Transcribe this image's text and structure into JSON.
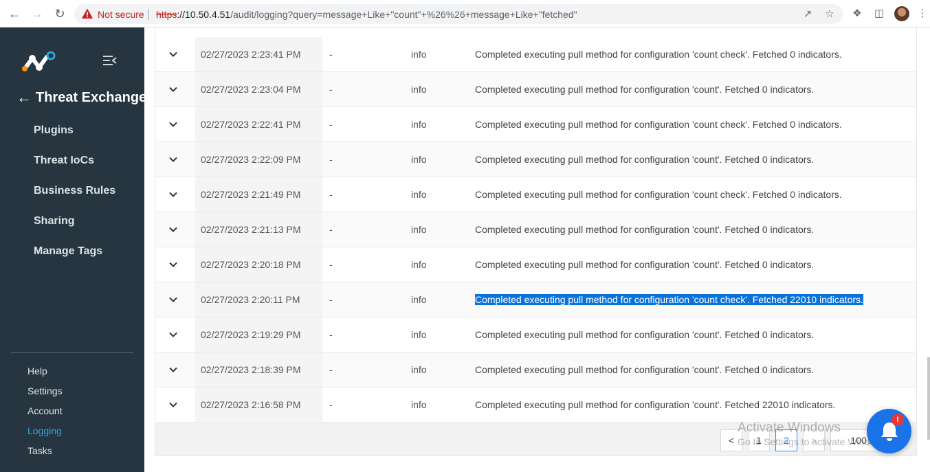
{
  "browser": {
    "security_label": "Not secure",
    "url_protocol": "https",
    "url_host": "://10.50.4.51",
    "url_path": "/audit/logging?query=message+Like+\"count\"+%26%26+message+Like+\"fetched\""
  },
  "sidebar": {
    "title": "Threat Exchange",
    "items": [
      {
        "label": "Plugins"
      },
      {
        "label": "Threat IoCs"
      },
      {
        "label": "Business Rules"
      },
      {
        "label": "Sharing"
      },
      {
        "label": "Manage Tags"
      }
    ],
    "bottom_items": [
      {
        "label": "Help"
      },
      {
        "label": "Settings"
      },
      {
        "label": "Account"
      },
      {
        "label": "Logging",
        "active": true
      },
      {
        "label": "Tasks"
      }
    ]
  },
  "logs": {
    "rows": [
      {
        "timestamp": "02/27/2023 2:23:41 PM",
        "source": "-",
        "level": "info",
        "message": "Completed executing pull method for configuration 'count check'. Fetched 0 indicators."
      },
      {
        "timestamp": "02/27/2023 2:23:04 PM",
        "source": "-",
        "level": "info",
        "message": "Completed executing pull method for configuration 'count'. Fetched 0 indicators."
      },
      {
        "timestamp": "02/27/2023 2:22:41 PM",
        "source": "-",
        "level": "info",
        "message": "Completed executing pull method for configuration 'count check'. Fetched 0 indicators."
      },
      {
        "timestamp": "02/27/2023 2:22:09 PM",
        "source": "-",
        "level": "info",
        "message": "Completed executing pull method for configuration 'count'. Fetched 0 indicators."
      },
      {
        "timestamp": "02/27/2023 2:21:49 PM",
        "source": "-",
        "level": "info",
        "message": "Completed executing pull method for configuration 'count check'. Fetched 0 indicators."
      },
      {
        "timestamp": "02/27/2023 2:21:13 PM",
        "source": "-",
        "level": "info",
        "message": "Completed executing pull method for configuration 'count'. Fetched 0 indicators."
      },
      {
        "timestamp": "02/27/2023 2:20:18 PM",
        "source": "-",
        "level": "info",
        "message": "Completed executing pull method for configuration 'count'. Fetched 0 indicators."
      },
      {
        "timestamp": "02/27/2023 2:20:11 PM",
        "source": "-",
        "level": "info",
        "message": "Completed executing pull method for configuration 'count check'. Fetched 22010 indicators.",
        "selected": true
      },
      {
        "timestamp": "02/27/2023 2:19:29 PM",
        "source": "-",
        "level": "info",
        "message": "Completed executing pull method for configuration 'count'. Fetched 0 indicators."
      },
      {
        "timestamp": "02/27/2023 2:18:39 PM",
        "source": "-",
        "level": "info",
        "message": "Completed executing pull method for configuration 'count'. Fetched 0 indicators."
      },
      {
        "timestamp": "02/27/2023 2:16:58 PM",
        "source": "-",
        "level": "info",
        "message": "Completed executing pull method for configuration 'count'. Fetched 22010 indicators."
      }
    ]
  },
  "pagination": {
    "prev": "<",
    "pages": [
      "1",
      "2"
    ],
    "current_page": "2",
    "next": ">",
    "page_size": "100 /"
  },
  "watermark": {
    "line1": "Activate Windows",
    "line2": "Go to Settings to activate Windows."
  },
  "notifications": {
    "badge": "!"
  },
  "colors": {
    "sidebar_bg": "#26353f",
    "accent": "#2aa8e0",
    "selection": "#0a73d9",
    "fab": "#1a73e8",
    "badge": "#e53935"
  }
}
